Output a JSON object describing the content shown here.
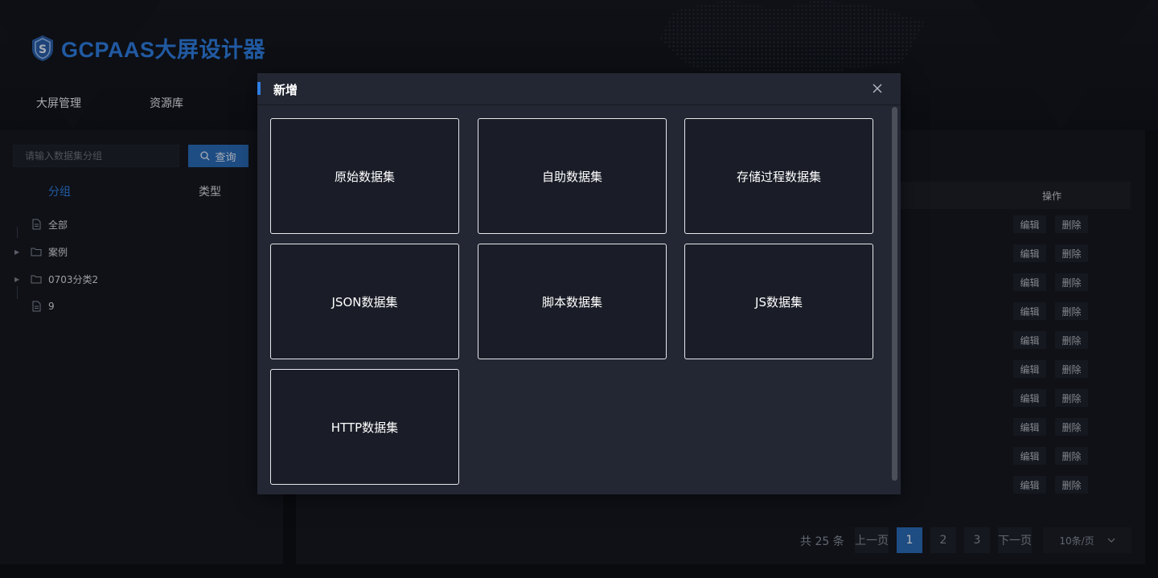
{
  "app": {
    "title": "GCPAAS大屏设计器"
  },
  "topnav": {
    "items": [
      "大屏管理",
      "资源库"
    ]
  },
  "sidebar": {
    "search_placeholder": "请输入数据集分组",
    "search_button": "查询",
    "tabs": [
      "分组",
      "类型"
    ],
    "tree": [
      {
        "label": "全部",
        "icon": "document-icon"
      },
      {
        "label": "案例",
        "icon": "folder-icon"
      },
      {
        "label": "0703分类2",
        "icon": "folder-icon"
      },
      {
        "label": "9",
        "icon": "document-icon"
      }
    ]
  },
  "table": {
    "action_header": "操作",
    "rows": [
      {
        "edit": "编辑",
        "delete": "删除"
      },
      {
        "edit": "编辑",
        "delete": "删除"
      },
      {
        "edit": "编辑",
        "delete": "删除"
      },
      {
        "edit": "编辑",
        "delete": "删除"
      },
      {
        "edit": "编辑",
        "delete": "删除"
      },
      {
        "edit": "编辑",
        "delete": "删除"
      },
      {
        "edit": "编辑",
        "delete": "删除"
      },
      {
        "edit": "编辑",
        "delete": "删除"
      },
      {
        "edit": "编辑",
        "delete": "删除"
      },
      {
        "edit": "编辑",
        "delete": "删除"
      }
    ]
  },
  "pagination": {
    "total": "共 25 条",
    "prev": "上一页",
    "pages": [
      "1",
      "2",
      "3"
    ],
    "current": "1",
    "next": "下一页",
    "page_size": "10条/页"
  },
  "dialog": {
    "title": "新增",
    "cards": [
      "原始数据集",
      "自助数据集",
      "存储过程数据集",
      "JSON数据集",
      "脚本数据集",
      "JS数据集",
      "HTTP数据集"
    ]
  },
  "colors": {
    "accent": "#2f7de1",
    "primary_button": "#2a6bb8",
    "dialog_bg": "#232733",
    "card_bg": "#1a1d27"
  }
}
